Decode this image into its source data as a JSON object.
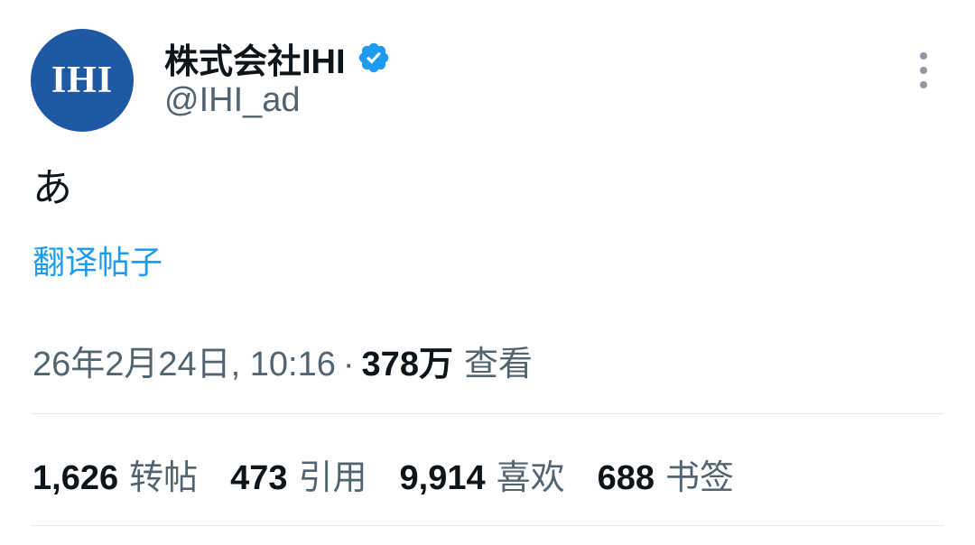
{
  "author": {
    "avatar_text": "IHI",
    "display_name": "株式会社IHI",
    "handle": "@IHI_ad",
    "verified_icon": "verified-badge-icon",
    "avatar_color": "#1f58a3",
    "verified_color": "#1d9bf0"
  },
  "post": {
    "text": "あ",
    "translate_label": "翻译帖子"
  },
  "meta": {
    "timestamp": "26年2月24日, 10:16",
    "separator": "·",
    "views_count": "378万",
    "views_label": "查看"
  },
  "stats": [
    {
      "count": "1,626",
      "label": "转帖"
    },
    {
      "count": "473",
      "label": "引用"
    },
    {
      "count": "9,914",
      "label": "喜欢"
    },
    {
      "count": "688",
      "label": "书签"
    }
  ],
  "colors": {
    "text_primary": "#0f1419",
    "text_secondary": "#536471",
    "link": "#1d9bf0",
    "divider": "#e1e8ed"
  }
}
